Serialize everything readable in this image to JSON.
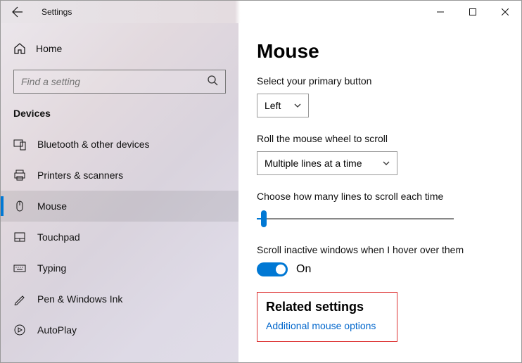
{
  "window": {
    "title": "Settings"
  },
  "sidebar": {
    "home": "Home",
    "search_placeholder": "Find a setting",
    "category": "Devices",
    "items": [
      {
        "label": "Bluetooth & other devices"
      },
      {
        "label": "Printers & scanners"
      },
      {
        "label": "Mouse"
      },
      {
        "label": "Touchpad"
      },
      {
        "label": "Typing"
      },
      {
        "label": "Pen & Windows Ink"
      },
      {
        "label": "AutoPlay"
      }
    ]
  },
  "main": {
    "heading": "Mouse",
    "primary_label": "Select your primary button",
    "primary_value": "Left",
    "wheel_label": "Roll the mouse wheel to scroll",
    "wheel_value": "Multiple lines at a time",
    "lines_label": "Choose how many lines to scroll each time",
    "inactive_label": "Scroll inactive windows when I hover over them",
    "toggle_value": "On",
    "related_heading": "Related settings",
    "related_link": "Additional mouse options"
  }
}
